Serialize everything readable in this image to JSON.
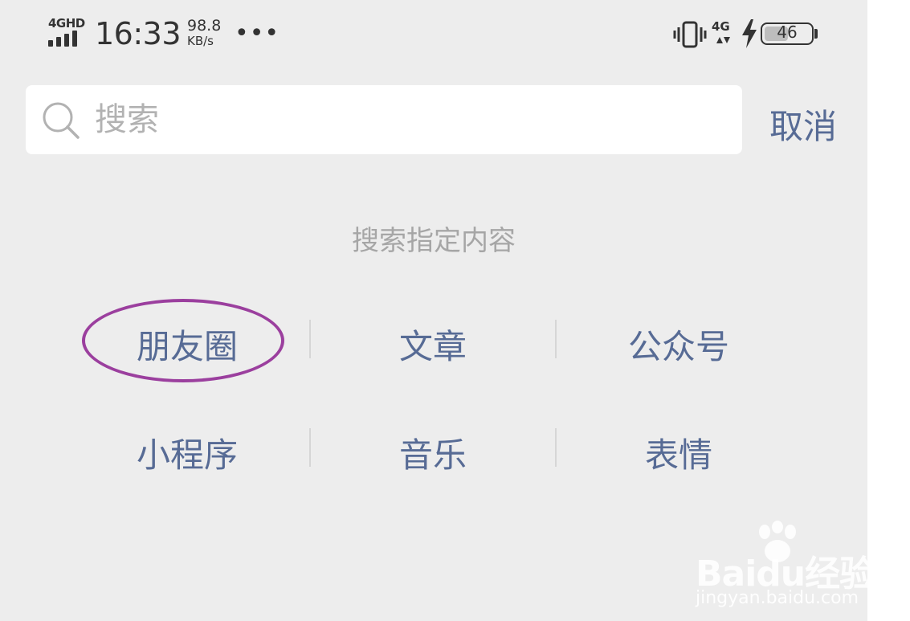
{
  "status_bar": {
    "network_type": "4GHD",
    "time": "16:33",
    "speed_value": "98.8",
    "speed_unit": "KB/s",
    "more_indicator": "•••",
    "mobile_data": "4G",
    "battery_level": "46"
  },
  "search": {
    "placeholder": "搜索",
    "value": "",
    "cancel_label": "取消"
  },
  "hint": "搜索指定内容",
  "categories": [
    {
      "label": "朋友圈"
    },
    {
      "label": "文章"
    },
    {
      "label": "公众号"
    },
    {
      "label": "小程序"
    },
    {
      "label": "音乐"
    },
    {
      "label": "表情"
    }
  ],
  "highlighted_category": "朋友圈",
  "watermark": {
    "logo_text": "Baidu经验",
    "url": "jingyan.baidu.com"
  },
  "colors": {
    "background": "#ededed",
    "link": "#576b95",
    "hint": "#a6a6a6",
    "highlight_ring": "#9b3f9e"
  }
}
